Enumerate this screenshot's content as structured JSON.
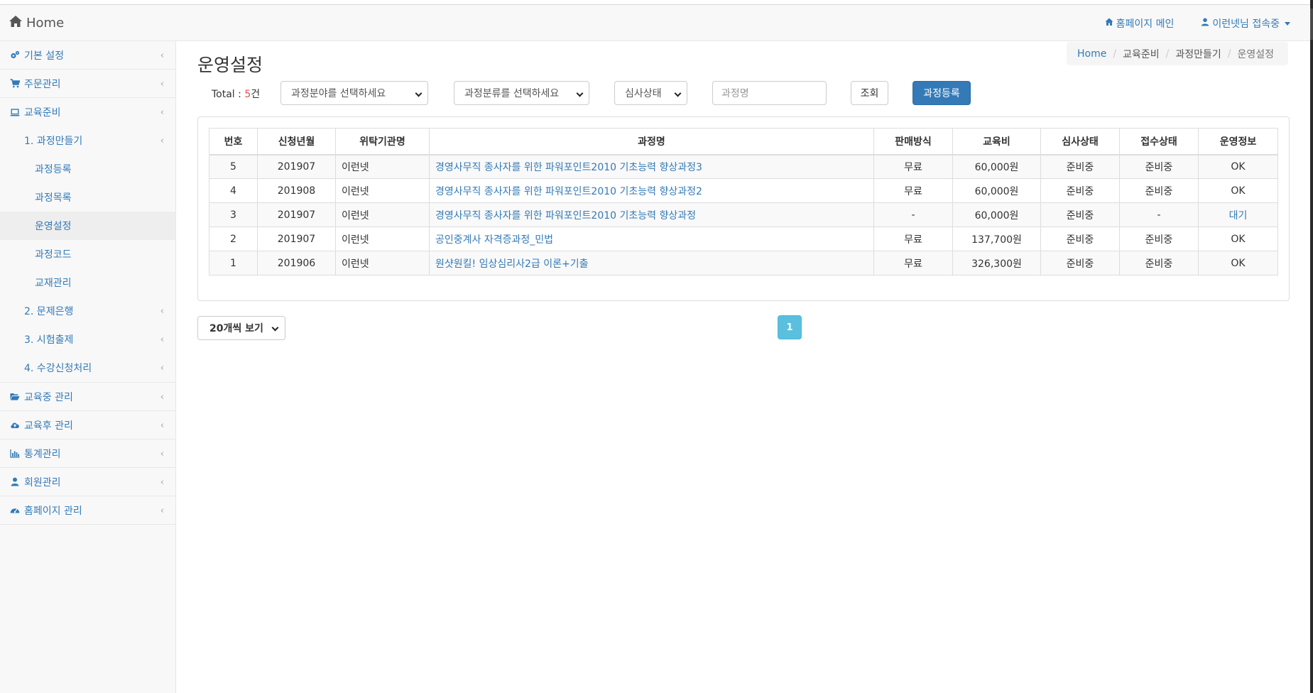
{
  "navbar": {
    "brand": "Home",
    "homepage_main": "홈페이지 메인",
    "user_status": "이런넷님 접속중"
  },
  "sidebar": {
    "basic_settings": "기본 설정",
    "order_mgmt": "주문관리",
    "edu_prep": "교육준비",
    "course_making": "1. 과정만들기",
    "course_register": "과정등록",
    "course_list": "과정목록",
    "operation_settings": "운영설정",
    "course_code": "과정코드",
    "textbook_mgmt": "교재관리",
    "question_bank": "2. 문제은행",
    "exam_making": "3. 시험출제",
    "enrollment": "4. 수강신청처리",
    "during_edu": "교육중 관리",
    "after_edu": "교육후 관리",
    "statistics": "통계관리",
    "members": "회원관리",
    "homepage_mgmt": "홈페이지 관리"
  },
  "page": {
    "title": "운영설정"
  },
  "breadcrumb": {
    "home": "Home",
    "level1": "교육준비",
    "level2": "과정만들기",
    "current": "운영설정"
  },
  "toolbar": {
    "total_label": "Total : ",
    "total_count": "5",
    "total_unit": "건",
    "field_select": "과정분야를 선택하세요",
    "category_select": "과정분류를 선택하세요",
    "review_select": "심사상태",
    "course_name_placeholder": "과정명",
    "search_button": "조회",
    "register_button": "과정등록"
  },
  "table": {
    "headers": [
      "번호",
      "신청년월",
      "위탁기관명",
      "과정명",
      "판매방식",
      "교육비",
      "심사상태",
      "접수상태",
      "운영정보"
    ],
    "rows": [
      [
        "5",
        "201907",
        "이런넷",
        "경영사무직 종사자를 위한 파워포인트2010 기초능력 향상과정3",
        "무료",
        "60,000원",
        "준비중",
        "준비중",
        "OK"
      ],
      [
        "4",
        "201908",
        "이런넷",
        "경영사무직 종사자를 위한 파워포인트2010 기초능력 향상과정2",
        "무료",
        "60,000원",
        "준비중",
        "준비중",
        "OK"
      ],
      [
        "3",
        "201907",
        "이런넷",
        "경영사무직 종사자를 위한 파워포인트2010 기초능력 향상과정",
        "-",
        "60,000원",
        "준비중",
        "-",
        "대기"
      ],
      [
        "2",
        "201907",
        "이런넷",
        "공인중계사 자격증과정_민법",
        "무료",
        "137,700원",
        "준비중",
        "준비중",
        "OK"
      ],
      [
        "1",
        "201906",
        "이런넷",
        "원샷원킬! 임상심리사2급 이론+기출",
        "무료",
        "326,300원",
        "준비중",
        "준비중",
        "OK"
      ]
    ]
  },
  "pagination": {
    "page_size": "20개씩 보기",
    "current_page": "1"
  }
}
